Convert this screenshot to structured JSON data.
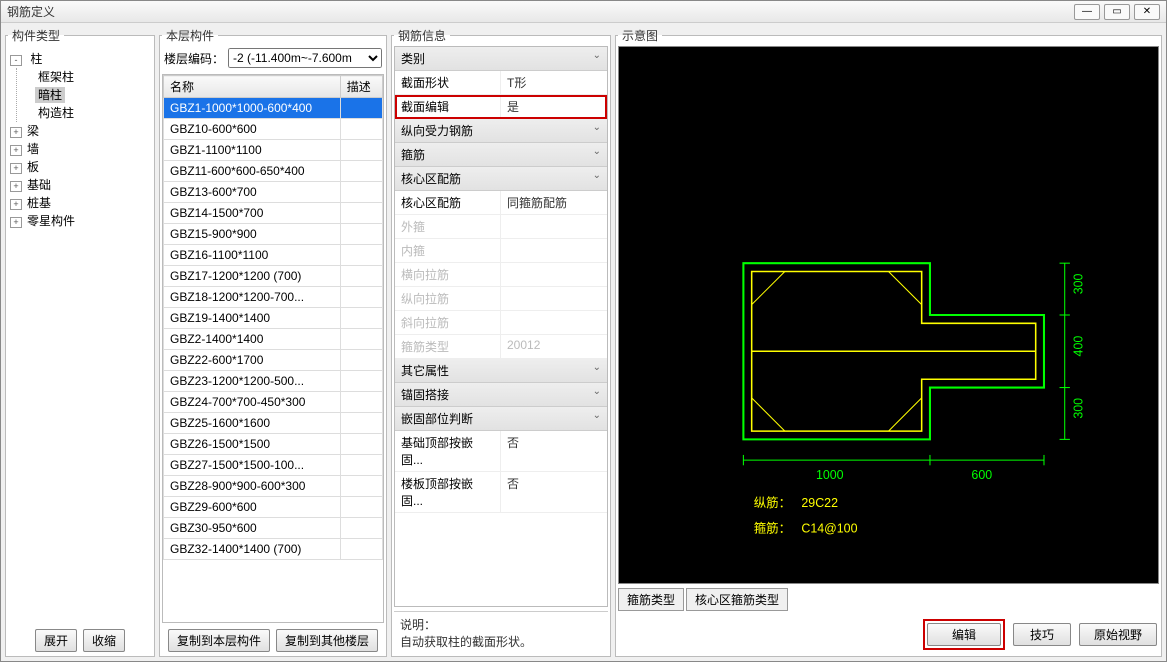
{
  "window": {
    "title": "钢筋定义"
  },
  "left": {
    "legend": "构件类型",
    "tree": {
      "root": "柱",
      "children": [
        "框架柱",
        "暗柱",
        "构造柱"
      ],
      "selectedChild": "暗柱",
      "collapsed": [
        "梁",
        "墙",
        "板",
        "基础",
        "桩基",
        "零星构件"
      ]
    },
    "expand": "展开",
    "collapse": "收缩"
  },
  "list": {
    "legend": "本层构件",
    "floorLabel": "楼层编码：",
    "floorValue": "-2 (-11.400m~-7.600m",
    "colName": "名称",
    "colDesc": "描述",
    "items": [
      "GBZ1-1000*1000-600*400",
      "GBZ10-600*600",
      "GBZ1-1100*1100",
      "GBZ11-600*600-650*400",
      "GBZ13-600*700",
      "GBZ14-1500*700",
      "GBZ15-900*900",
      "GBZ16-1100*1100",
      "GBZ17-1200*1200 (700)",
      "GBZ18-1200*1200-700...",
      "GBZ19-1400*1400",
      "GBZ2-1400*1400",
      "GBZ22-600*1700",
      "GBZ23-1200*1200-500...",
      "GBZ24-700*700-450*300",
      "GBZ25-1600*1600",
      "GBZ26-1500*1500",
      "GBZ27-1500*1500-100...",
      "GBZ28-900*900-600*300",
      "GBZ29-600*600",
      "GBZ30-950*600",
      "GBZ32-1400*1400 (700)"
    ],
    "selectedIndex": 0,
    "copyLayer": "复制到本层构件",
    "copyOther": "复制到其他楼层"
  },
  "info": {
    "legend": "钢筋信息",
    "groups": {
      "category": "类别",
      "long": "纵向受力钢筋",
      "stirrup": "箍筋",
      "core": "核心区配筋",
      "other": "其它属性",
      "anchor": "锚固搭接",
      "embed": "嵌固部位判断"
    },
    "rows": {
      "sectionShape": {
        "k": "截面形状",
        "v": "T形"
      },
      "sectionEdit": {
        "k": "截面编辑",
        "v": "是"
      },
      "coreReinf": {
        "k": "核心区配筋",
        "v": "同箍筋配筋"
      },
      "outerStirrup": {
        "k": "外箍",
        "v": ""
      },
      "innerStirrup": {
        "k": "内箍",
        "v": ""
      },
      "horizTie": {
        "k": "横向拉筋",
        "v": ""
      },
      "vertTie": {
        "k": "纵向拉筋",
        "v": ""
      },
      "diagTie": {
        "k": "斜向拉筋",
        "v": ""
      },
      "stirrupType": {
        "k": "箍筋类型",
        "v": "20012"
      },
      "baseTop": {
        "k": "基础顶部按嵌固...",
        "v": "否"
      },
      "slabTop": {
        "k": "楼板顶部按嵌固...",
        "v": "否"
      }
    },
    "descLabel": "说明：",
    "descText": "自动获取柱的截面形状。"
  },
  "right": {
    "legend": "示意图",
    "tabs": [
      "箍筋类型",
      "核心区箍筋类型"
    ],
    "edit": "编辑",
    "tips": "技巧",
    "origView": "原始视野"
  },
  "chart_data": {
    "type": "diagram",
    "title": "T形截面示意",
    "dimensions": {
      "left_width": 1000,
      "left_height_top": 300,
      "left_height_bottom": 300,
      "right_width": 600,
      "right_height": 400,
      "total_height": 1000
    },
    "annotations": [
      {
        "label": "纵筋：",
        "value": "29C22"
      },
      {
        "label": "箍筋：",
        "value": "C14@100"
      }
    ],
    "dim_labels": {
      "d300": "300",
      "d400": "400",
      "d1000": "1000",
      "d600": "600"
    }
  }
}
